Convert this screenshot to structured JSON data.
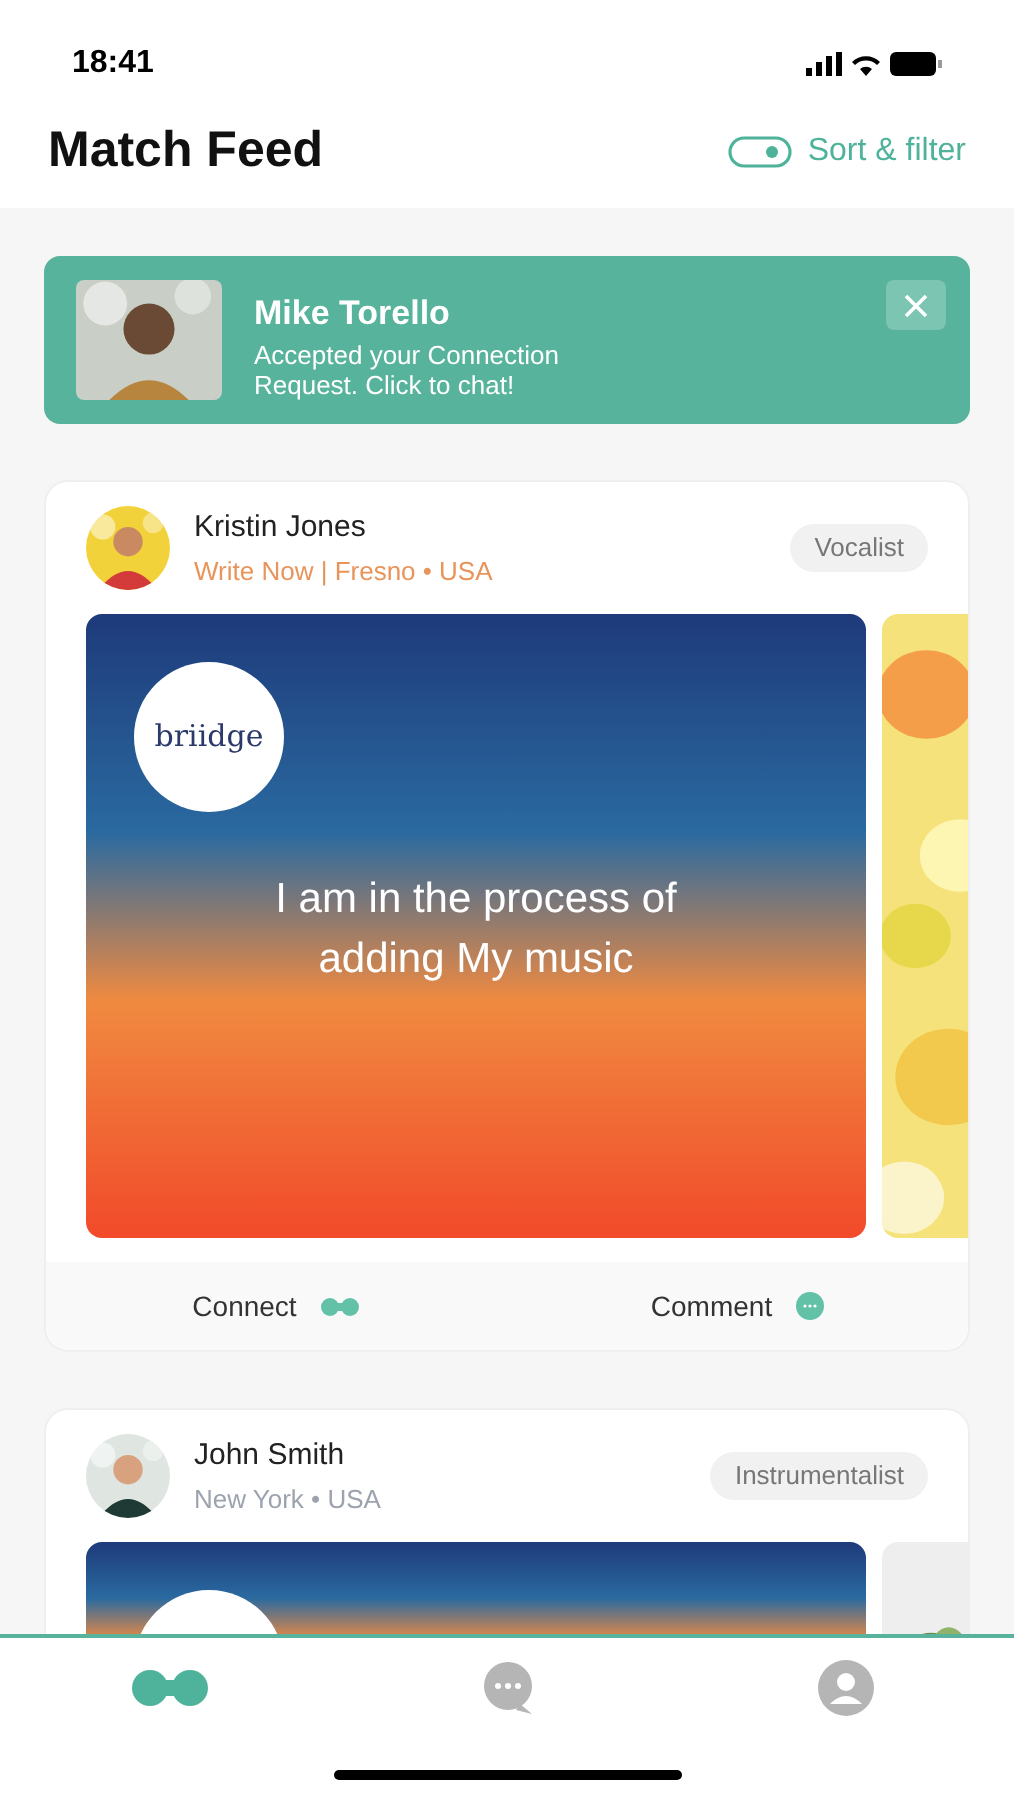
{
  "status_bar": {
    "time": "18:41"
  },
  "header": {
    "title": "Match Feed",
    "sort_filter": "Sort & filter"
  },
  "notification": {
    "name": "Mike Torello",
    "message": "Accepted your Connection Request. Click to chat!"
  },
  "posts": [
    {
      "name": "Kristin Jones",
      "subtitle": "Write Now | Fresno • USA",
      "color": "#e8945a",
      "role": "Vocalist",
      "graphic": {
        "logo": "briidge",
        "caption": "I am in the process of adding My music"
      },
      "actions": {
        "connect": "Connect",
        "comment": "Comment"
      }
    },
    {
      "name": "John Smith",
      "subtitle": "New York • USA",
      "color": "#9ca3af",
      "role": "Instrumentalist"
    }
  ],
  "tabs": [
    {
      "kind": "match",
      "selected": true
    },
    {
      "kind": "chat",
      "selected": false
    },
    {
      "kind": "profile",
      "selected": false
    }
  ]
}
